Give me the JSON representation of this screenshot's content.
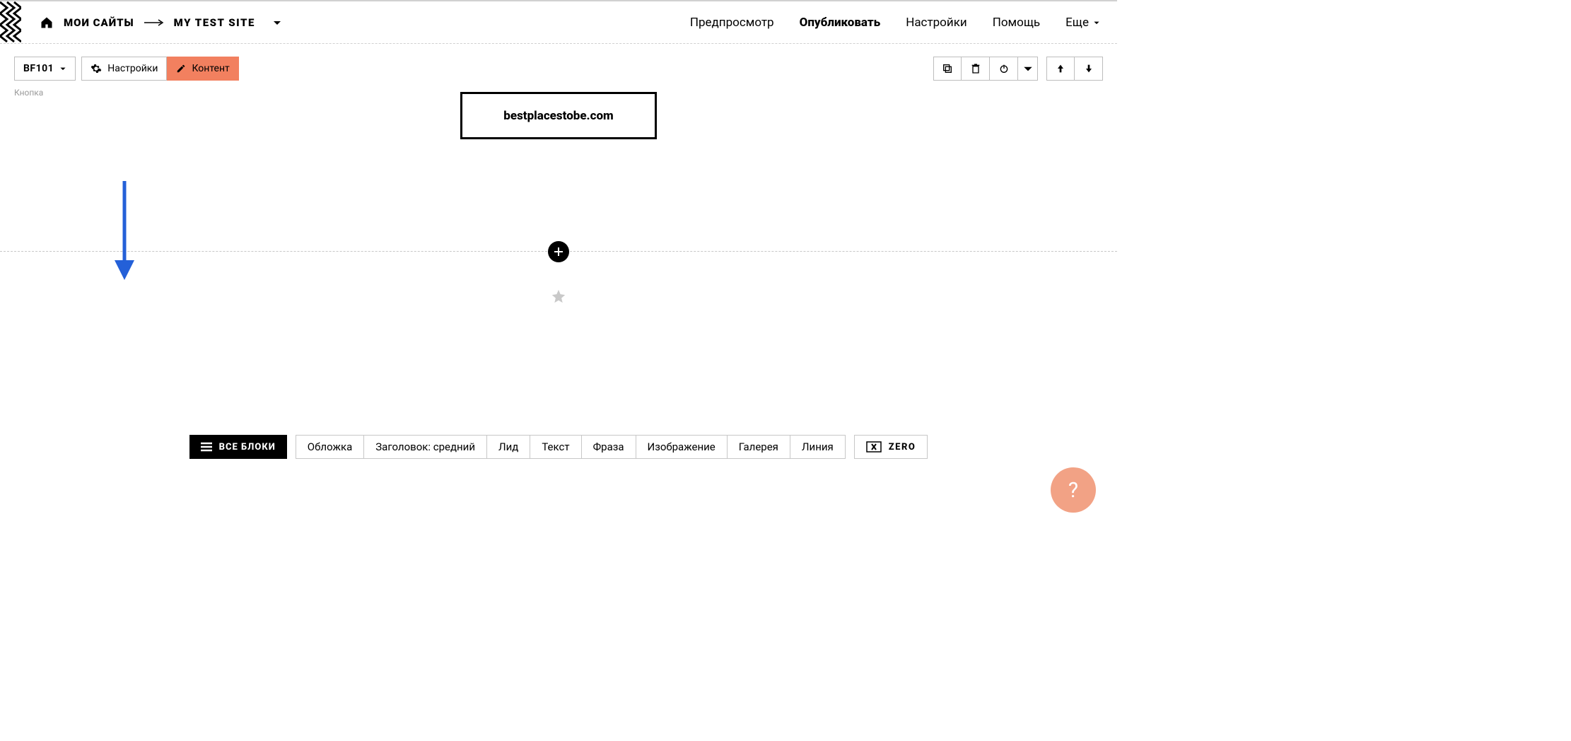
{
  "breadcrumb": {
    "my_sites": "МОИ САЙТЫ",
    "site_name": "MY TEST SITE"
  },
  "topnav": {
    "preview": "Предпросмотр",
    "publish": "Опубликовать",
    "settings": "Настройки",
    "help": "Помощь",
    "more": "Еще"
  },
  "block_toolbar": {
    "block_id": "BF101",
    "settings": "Настройки",
    "content": "Контент",
    "caption": "Кнопка"
  },
  "canvas": {
    "button_label": "bestplacestobe.com"
  },
  "block_picker": {
    "all_blocks": "ВСЕ БЛОКИ",
    "types": [
      "Обложка",
      "Заголовок: средний",
      "Лид",
      "Текст",
      "Фраза",
      "Изображение",
      "Галерея",
      "Линия"
    ],
    "zero": "ZERO"
  },
  "help_bubble": "?"
}
